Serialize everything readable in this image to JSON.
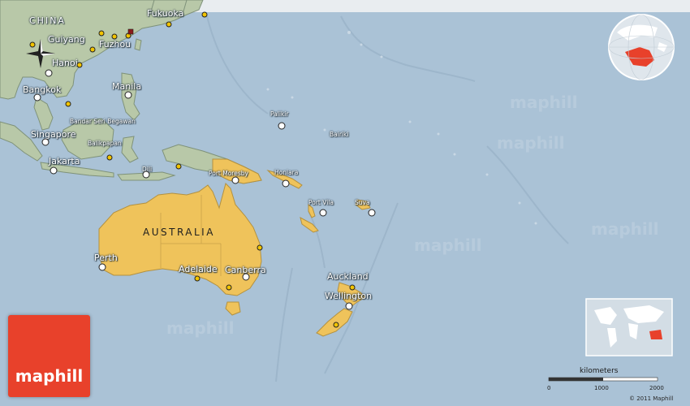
{
  "map": {
    "colors": {
      "ocean": "#aac2d6",
      "highlight_land": "#efc35b",
      "other_land": "#b8c8a8",
      "capital_marker": "#ffffff",
      "city_marker": "#f2c400",
      "brand": "#e8412b"
    },
    "countries": {
      "australia": "AUSTRALIA",
      "china": "CHINA"
    },
    "cities": {
      "fukuoka": "Fukuoka",
      "guiyang": "Guiyang",
      "fuzhou": "Fuzhou",
      "hanoi": "Hanoi",
      "bangkok": "Bangkok",
      "manila": "Manila",
      "bandar_seri_begawan": "Bandar Seri Begawan",
      "singapore": "Singapore",
      "balikpapan": "Balikpapan",
      "jakarta": "Jakarta",
      "dili": "Dili",
      "port_moresby": "Port Moresby",
      "honiara": "Honiara",
      "palikir": "Palikir",
      "bairiki": "Bairiki",
      "port_vila": "Port Vila",
      "suva": "Suva",
      "perth": "Perth",
      "adelaide": "Adelaide",
      "canberra": "Canberra",
      "auckland": "Auckland",
      "wellington": "Wellington"
    },
    "watermark": "maphill",
    "brand": "maphill",
    "scale": {
      "unit": "kilometers",
      "ticks": [
        "0",
        "1000",
        "2000"
      ]
    },
    "copyright": "© 2011 Maphill"
  }
}
